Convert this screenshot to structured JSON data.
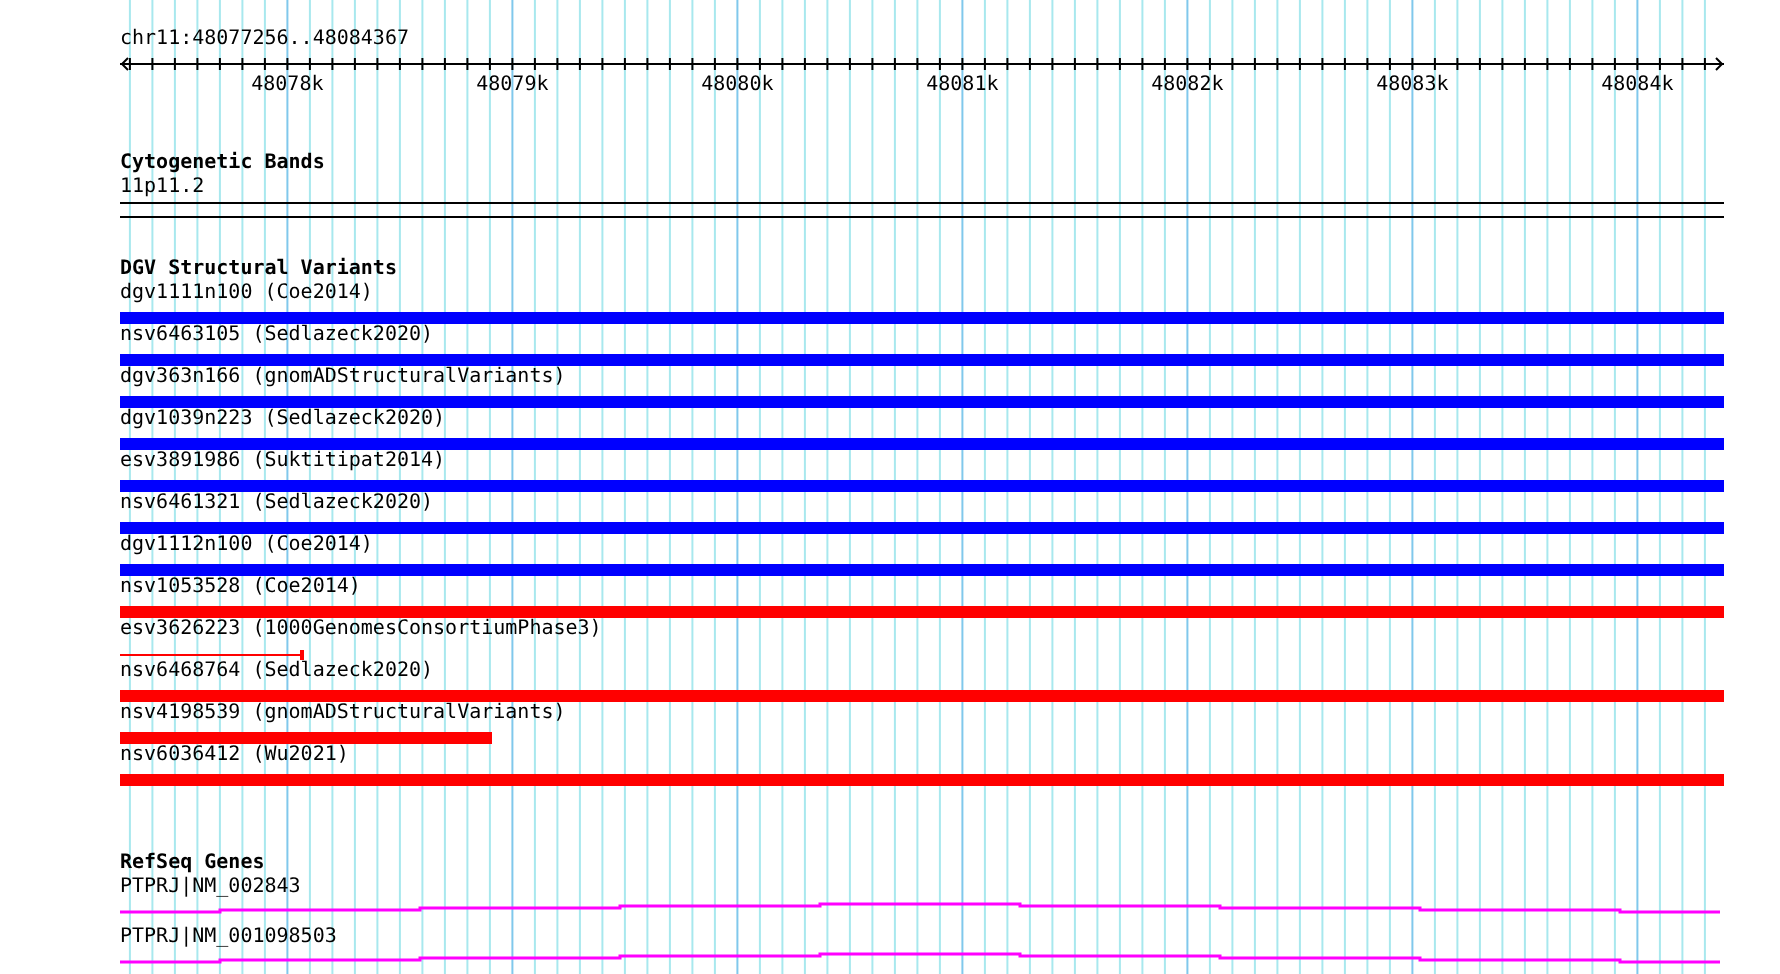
{
  "ruler": {
    "range": "chr11:48077256..48084367",
    "tick_labels": [
      "48078k",
      "48079k",
      "48080k",
      "48081k",
      "48082k",
      "48083k",
      "48084k"
    ]
  },
  "cytogenetic_bands": {
    "title": "Cytogenetic Bands",
    "band": "11p11.2"
  },
  "dgv_structural_variants": {
    "title": "DGV Structural Variants",
    "variants": [
      {
        "name": "dgv1111n100 (Coe2014)",
        "color": "#0000ff",
        "kind": "bar"
      },
      {
        "name": "nsv6463105 (Sedlazeck2020)",
        "color": "#0000ff",
        "kind": "bar"
      },
      {
        "name": "dgv363n166 (gnomADStructuralVariants)",
        "color": "#0000ff",
        "kind": "bar"
      },
      {
        "name": "dgv1039n223 (Sedlazeck2020)",
        "color": "#0000ff",
        "kind": "bar"
      },
      {
        "name": "esv3891986 (Suktitipat2014)",
        "color": "#0000ff",
        "kind": "bar"
      },
      {
        "name": "nsv6461321 (Sedlazeck2020)",
        "color": "#0000ff",
        "kind": "bar"
      },
      {
        "name": "dgv1112n100 (Coe2014)",
        "color": "#0000ff",
        "kind": "bar"
      },
      {
        "name": "nsv1053528 (Coe2014)",
        "color": "#ff0000",
        "kind": "bar"
      },
      {
        "name": "esv3626223 (1000GenomesConsortiumPhase3)",
        "color": "#ff0000",
        "kind": "short_line"
      },
      {
        "name": "nsv6468764 (Sedlazeck2020)",
        "color": "#ff0000",
        "kind": "bar"
      },
      {
        "name": "nsv4198539 (gnomADStructuralVariants)",
        "color": "#ff0000",
        "kind": "short_bar"
      },
      {
        "name": "nsv6036412 (Wu2021)",
        "color": "#ff0000",
        "kind": "bar"
      }
    ]
  },
  "refseq_genes": {
    "title": "RefSeq Genes",
    "genes": [
      {
        "name": "PTPRJ|NM_002843"
      },
      {
        "name": "PTPRJ|NM_001098503"
      }
    ]
  }
}
